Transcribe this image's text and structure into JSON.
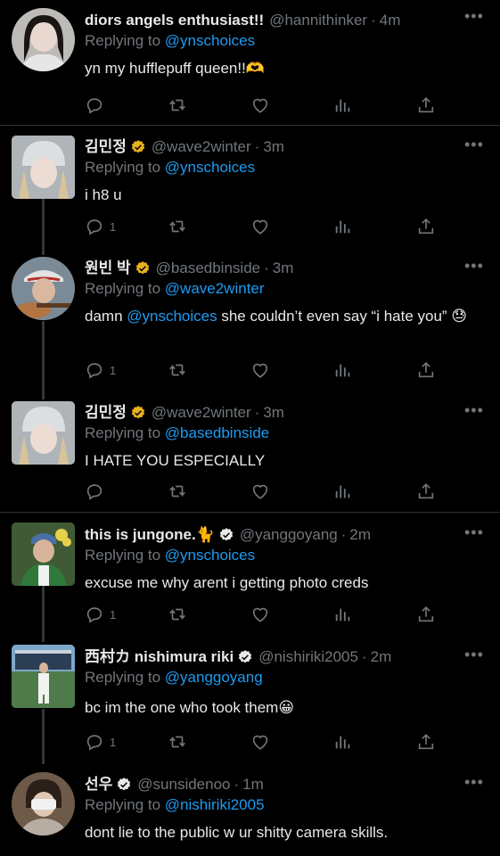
{
  "reply_prefix": "Replying to ",
  "tweets": [
    {
      "name": "diors angels enthusiast!!",
      "verified": false,
      "handle": "@hannithinker",
      "time": "4m",
      "reply_to": "@ynschoices",
      "text": "yn my hufflepuff queen!!🫶",
      "replies": "",
      "avatar_color": "#bdbbb7"
    },
    {
      "name": "김민정",
      "verified": true,
      "badge_color": "#e8b21e",
      "handle": "@wave2winter",
      "time": "3m",
      "reply_to": "@ynschoices",
      "text": "i h8 u",
      "replies": "1",
      "avatar_color": "#cfd3d6"
    },
    {
      "name": "원빈 박",
      "verified": true,
      "badge_color": "#e8b21e",
      "handle": "@basedbinside",
      "time": "3m",
      "reply_to": "@wave2winter",
      "text_pre": "damn ",
      "mention": "@ynschoices",
      "text_post": " she couldn’t even say “i hate you” 😓",
      "replies": "1",
      "avatar_color": "#7a8a96"
    },
    {
      "name": "김민정",
      "verified": true,
      "badge_color": "#e8b21e",
      "handle": "@wave2winter",
      "time": "3m",
      "reply_to": "@basedbinside",
      "text": "I HATE YOU ESPECIALLY",
      "replies": "",
      "avatar_color": "#cfd3d6"
    },
    {
      "name": "this is jungone.🐈",
      "verified": true,
      "badge_color": "#e7e9ea",
      "handle": "@yanggoyang",
      "time": "2m",
      "reply_to": "@ynschoices",
      "text": "excuse me why arent i getting photo creds",
      "replies": "1",
      "avatar_color": "#5e7d4a"
    },
    {
      "name": "西村カ nishimura riki",
      "verified": true,
      "badge_color": "#e7e9ea",
      "handle": "@nishiriki2005",
      "time": "2m",
      "reply_to": "@yanggoyang",
      "text": "bc im the one who took them😀",
      "replies": "1",
      "avatar_color": "#4f7a4a"
    },
    {
      "name": "선우",
      "verified": true,
      "badge_color": "#e7e9ea",
      "handle": "@sunsidenoo",
      "time": "1m",
      "reply_to": "@nishiriki2005",
      "text": "dont lie to the public w ur shitty camera skills.",
      "replies": "",
      "avatar_color": "#6e5a48"
    }
  ],
  "colors": {
    "background": "#000000",
    "text": "#e7e9ea",
    "muted": "#71767b",
    "link": "#1d9bf0",
    "divider": "#2f3336"
  },
  "icons": [
    "reply-icon",
    "retweet-icon",
    "like-icon",
    "views-icon",
    "share-icon",
    "more-icon",
    "verified-badge-icon"
  ]
}
